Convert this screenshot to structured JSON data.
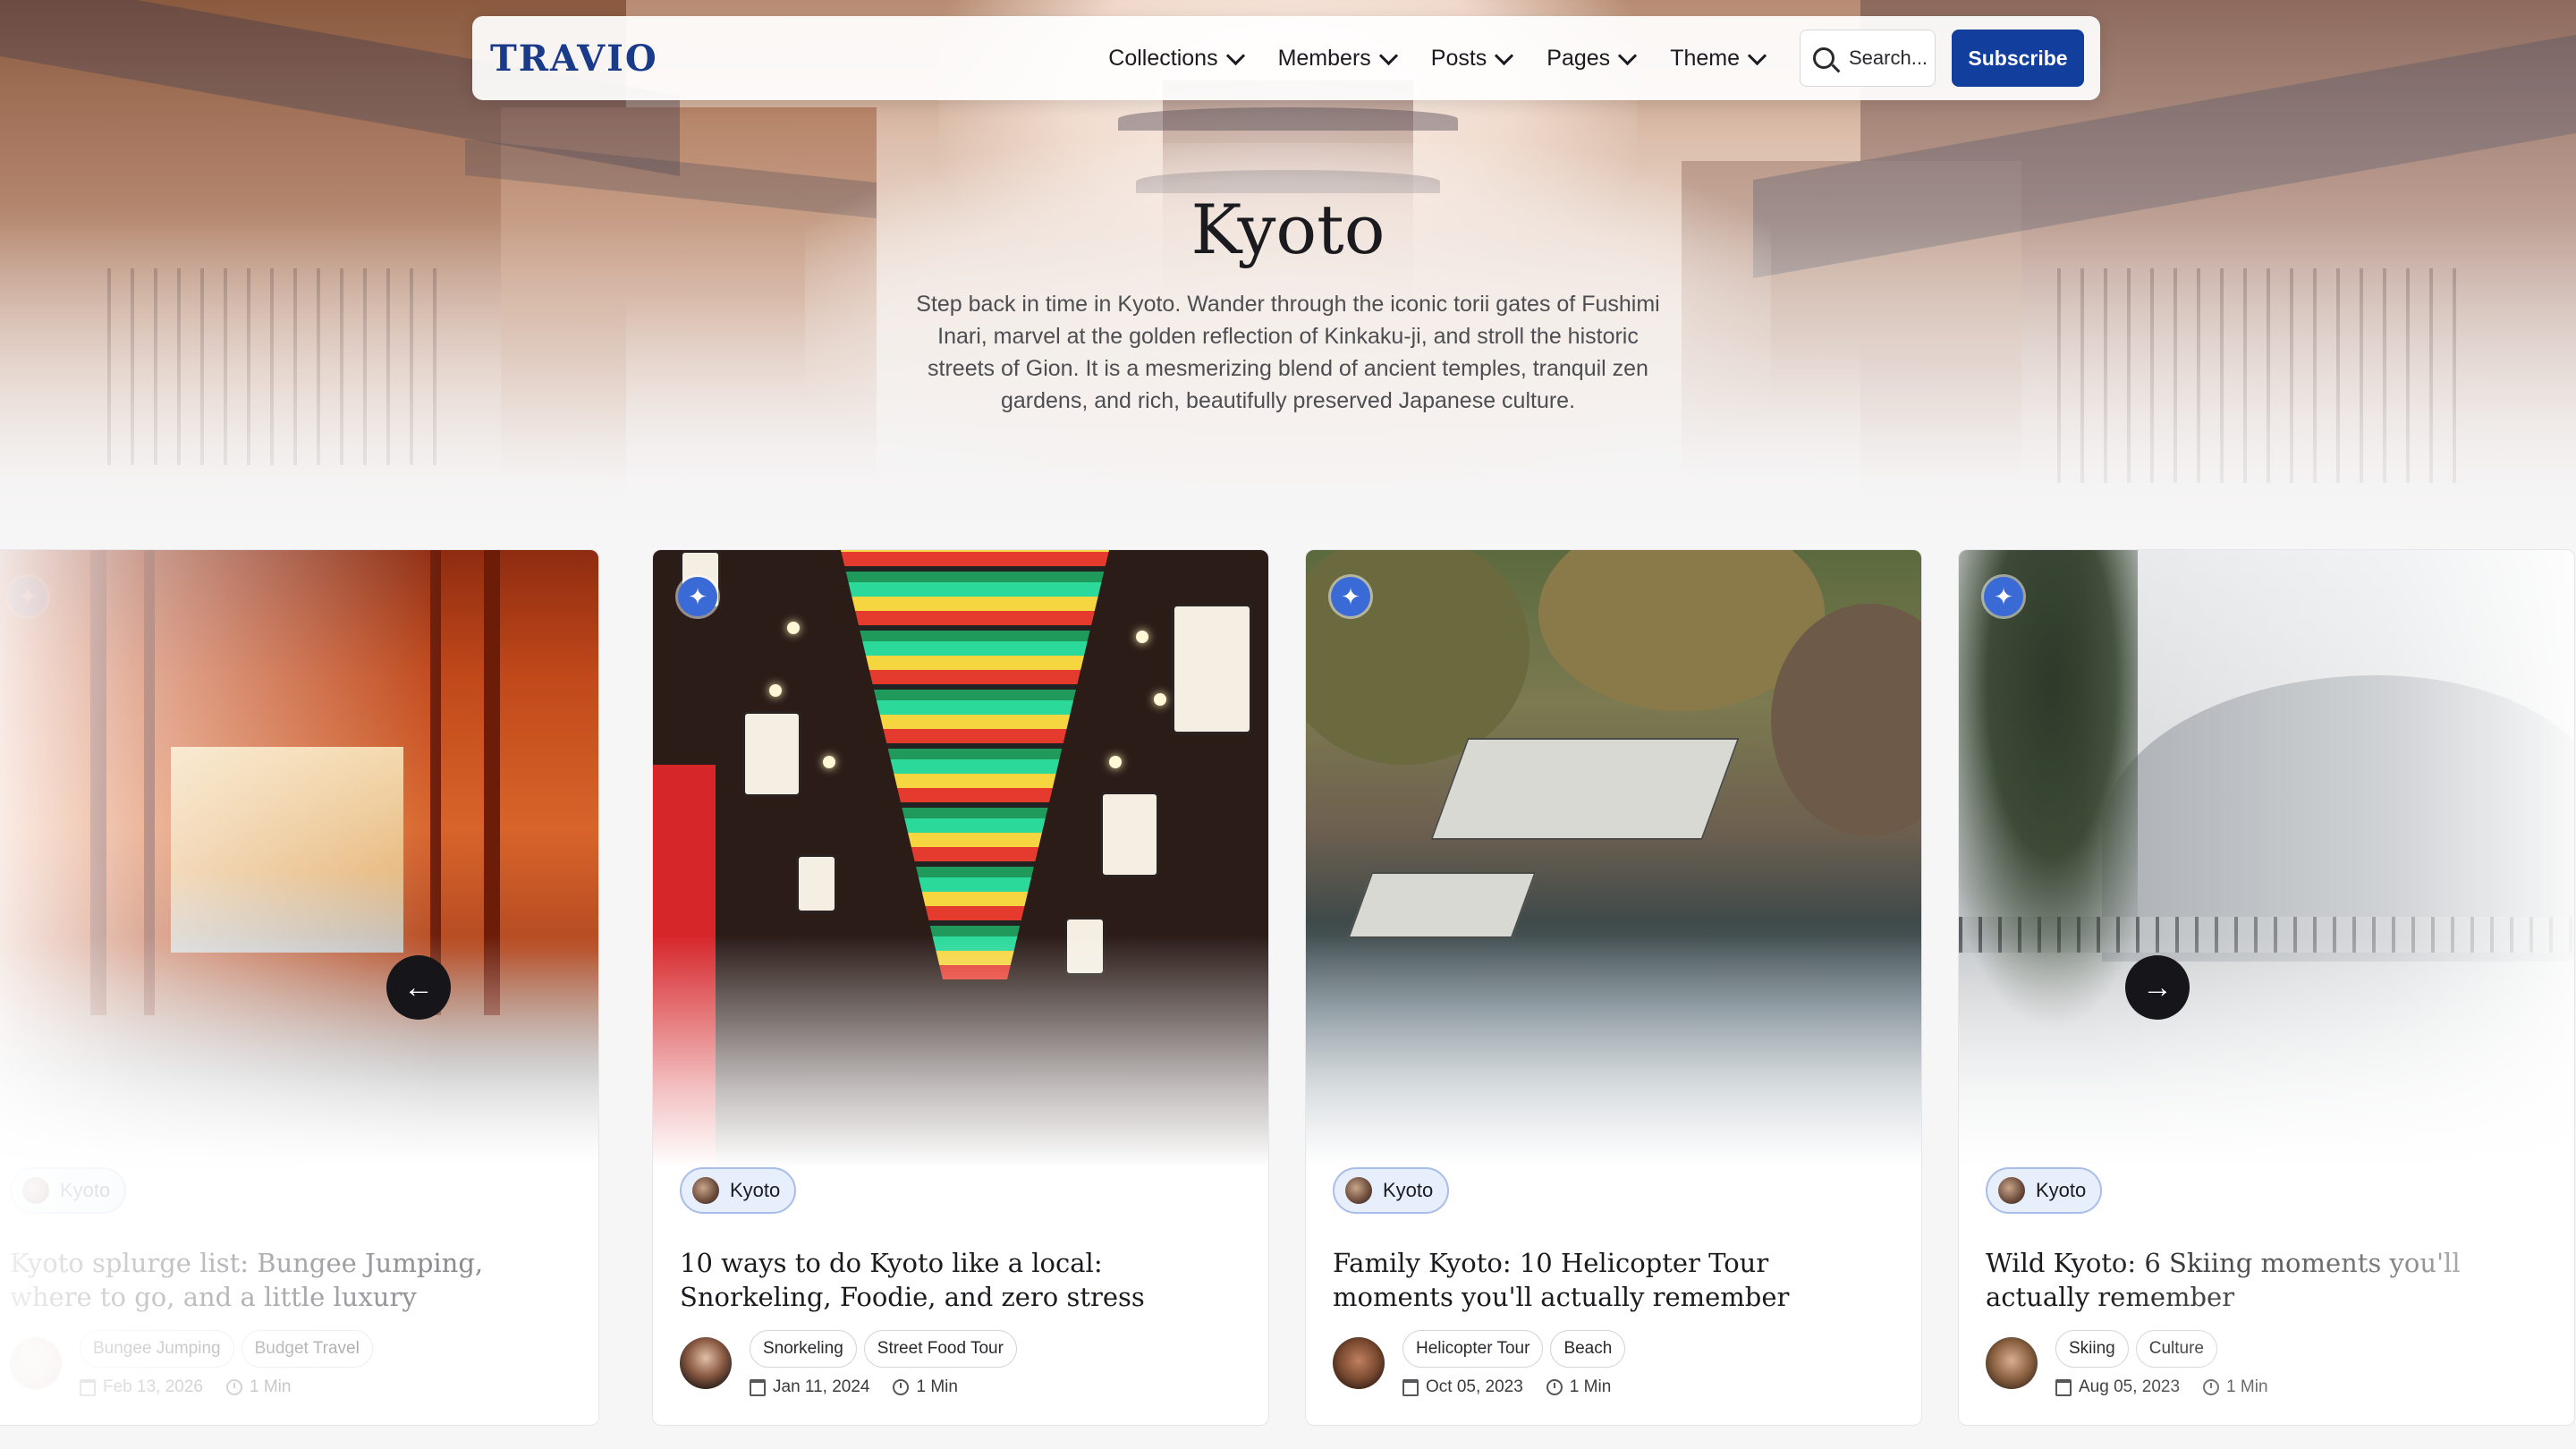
{
  "nav": {
    "logo": "TRAVIO",
    "menu": [
      {
        "label": "Collections"
      },
      {
        "label": "Members"
      },
      {
        "label": "Posts"
      },
      {
        "label": "Pages"
      },
      {
        "label": "Theme"
      }
    ],
    "search_label": "Search...",
    "subscribe_label": "Subscribe"
  },
  "hero": {
    "title": "Kyoto",
    "description": "Step back in time in Kyoto. Wander through the iconic torii gates of Fushimi Inari, marvel at the golden reflection of Kinkaku-ji, and stroll the historic streets of Gion. It is a mesmerizing blend of ancient temples, tranquil zen gardens, and rich, beautifully preserved Japanese culture."
  },
  "carousel": {
    "prev_icon": "arrow-left-icon",
    "next_icon": "arrow-right-icon",
    "cards": [
      {
        "tag": "Kyoto",
        "title": "Kyoto splurge list: Bungee Jumping, where to go, and a little luxury",
        "chips": [
          "Bungee Jumping",
          "Budget Travel"
        ],
        "date": "Feb 13, 2026",
        "read_time": "1 Min"
      },
      {
        "tag": "Kyoto",
        "title": "10 ways to do Kyoto like a local: Snorkeling, Foodie, and zero stress",
        "chips": [
          "Snorkeling",
          "Street Food Tour"
        ],
        "date": "Jan 11, 2024",
        "read_time": "1 Min"
      },
      {
        "tag": "Kyoto",
        "title": "Family Kyoto: 10 Helicopter Tour moments you'll actually remember",
        "chips": [
          "Helicopter Tour",
          "Beach"
        ],
        "date": "Oct 05, 2023",
        "read_time": "1 Min"
      },
      {
        "tag": "Kyoto",
        "title": "Wild Kyoto: 6 Skiing moments you'll actually remember",
        "chips": [
          "Skiing",
          "Culture"
        ],
        "date": "Aug 05, 2023",
        "read_time": "1 Min"
      }
    ]
  },
  "colors": {
    "brand": "#123f9e",
    "logo": "#1a3a8a",
    "featured_badge": "#3a6ad6",
    "tag_bg": "#e7eefc"
  }
}
